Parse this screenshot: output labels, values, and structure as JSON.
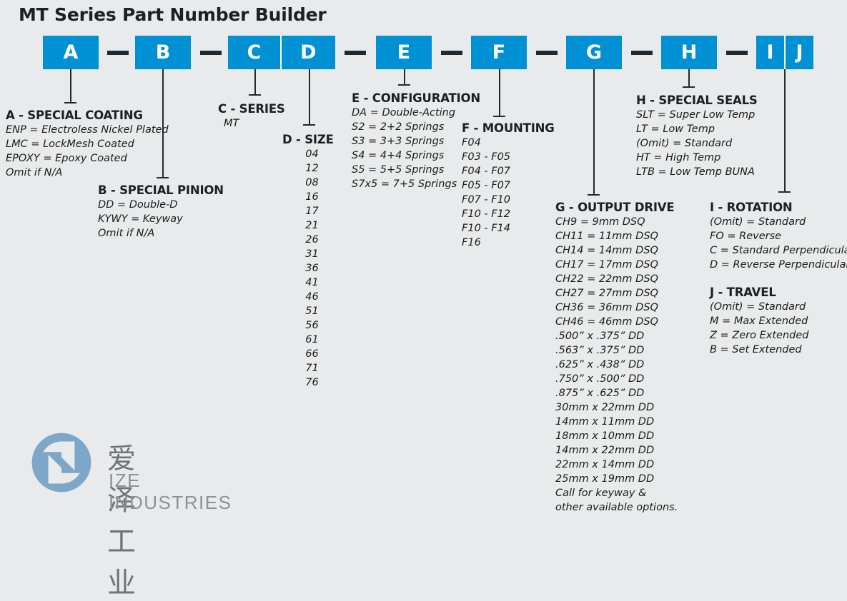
{
  "title": "MT Series Part Number Builder",
  "colors": {
    "box_blue": "#0090d4",
    "background": "#e8eaeb",
    "dark": "#1b2a35",
    "logo_blue": "#7da7c9",
    "logo_gray": "#6e7478"
  },
  "code_boxes": [
    {
      "name": "box-a",
      "label": "A"
    },
    {
      "name": "box-b",
      "label": "B"
    },
    {
      "name": "box-cd",
      "labels": [
        "C",
        "D"
      ]
    },
    {
      "name": "box-e",
      "label": "E"
    },
    {
      "name": "box-f",
      "label": "F"
    },
    {
      "name": "box-g",
      "label": "G"
    },
    {
      "name": "box-h",
      "label": "H"
    },
    {
      "name": "box-ij",
      "labels": [
        "I",
        "J"
      ]
    }
  ],
  "sections": {
    "a": {
      "heading": "A - SPECIAL COATING",
      "items": [
        "ENP = Electroless Nickel Plated",
        "LMC = LockMesh Coated",
        "EPOXY = Epoxy Coated",
        "Omit if N/A"
      ]
    },
    "b": {
      "heading": "B - SPECIAL PINION",
      "items": [
        "DD = Double-D",
        "KYWY = Keyway",
        "Omit if N/A"
      ]
    },
    "c": {
      "heading": "C - SERIES",
      "items": [
        "MT"
      ]
    },
    "d": {
      "heading": "D - SIZE",
      "items": [
        "04",
        "12",
        "08",
        "16",
        "17",
        "21",
        "26",
        "31",
        "36",
        "41",
        "46",
        "51",
        "56",
        "61",
        "66",
        "71",
        "76"
      ]
    },
    "e": {
      "heading": "E - CONFIGURATION",
      "items": [
        "DA = Double-Acting",
        "S2 = 2+2 Springs",
        "S3 = 3+3 Springs",
        "S4 = 4+4 Springs",
        "S5 = 5+5 Springs",
        "S7x5 = 7+5 Springs"
      ]
    },
    "f": {
      "heading": "F - MOUNTING",
      "items": [
        "F04",
        "F03 - F05",
        "F04 - F07",
        "F05 - F07",
        "F07 - F10",
        "F10 - F12",
        "F10 - F14",
        "F16"
      ]
    },
    "g": {
      "heading": "G - OUTPUT DRIVE",
      "items": [
        "CH9 = 9mm DSQ",
        "CH11 = 11mm DSQ",
        "CH14 = 14mm DSQ",
        "CH17 = 17mm DSQ",
        "CH22 = 22mm DSQ",
        "CH27 = 27mm DSQ",
        "CH36 = 36mm DSQ",
        "CH46 = 46mm DSQ",
        ".500” x .375” DD",
        ".563” x .375” DD",
        ".625” x .438” DD",
        ".750” x .500” DD",
        ".875” x .625” DD",
        "30mm x 22mm DD",
        "14mm x 11mm DD",
        "18mm x 10mm DD",
        "14mm x 22mm DD",
        "22mm x 14mm DD",
        "25mm x 19mm DD",
        "Call for keyway &",
        "other available options."
      ]
    },
    "h": {
      "heading": "H - SPECIAL SEALS",
      "items": [
        "SLT = Super Low Temp",
        "LT = Low Temp",
        "(Omit) = Standard",
        "HT = High Temp",
        "LTB = Low Temp BUNA"
      ]
    },
    "i": {
      "heading": "I - ROTATION",
      "items": [
        "(Omit) = Standard",
        "FO = Reverse",
        "C = Standard Perpendicular",
        "D = Reverse Perpendicular"
      ]
    },
    "j": {
      "heading": "J - TRAVEL",
      "items": [
        "(Omit) = Standard",
        "M = Max Extended",
        "Z = Zero Extended",
        "B = Set Extended"
      ]
    }
  },
  "logo": {
    "chinese": "爱泽工业",
    "english": "IZE INDUSTRIES"
  }
}
